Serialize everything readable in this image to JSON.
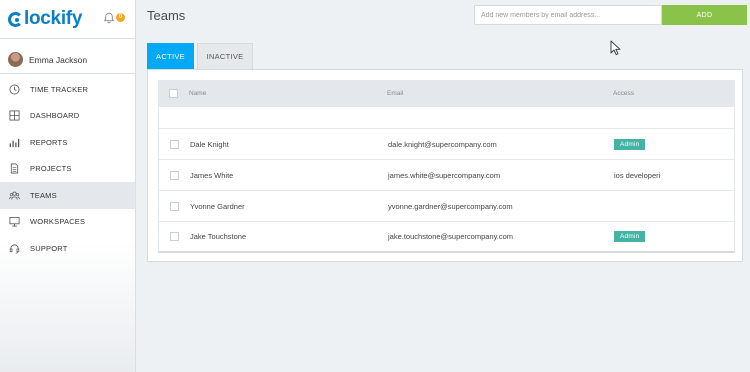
{
  "app": {
    "logo_text": "lockify",
    "notification_count": "0"
  },
  "user": {
    "name": "Emma Jackson"
  },
  "sidebar": {
    "items": [
      {
        "label": "TIME TRACKER",
        "icon": "clock-icon"
      },
      {
        "label": "DASHBOARD",
        "icon": "grid-icon"
      },
      {
        "label": "REPORTS",
        "icon": "bar-chart-icon"
      },
      {
        "label": "PROJECTS",
        "icon": "document-icon"
      },
      {
        "label": "TEAMS",
        "icon": "team-icon",
        "active": true
      },
      {
        "label": "WORKSPACES",
        "icon": "monitor-icon"
      },
      {
        "label": "SUPPORT",
        "icon": "headset-icon"
      }
    ]
  },
  "page": {
    "title": "Teams"
  },
  "invite": {
    "placeholder": "Add new members by email address...",
    "add_label": "ADD"
  },
  "tabs": {
    "active": "ACTIVE",
    "inactive": "INACTIVE"
  },
  "table": {
    "columns": {
      "name": "Name",
      "email": "Email",
      "access": "Access"
    },
    "rows": [
      {
        "name": "Dale Knight",
        "email": "dale.knight@supercompany.com",
        "access": "Admin",
        "access_badge": true
      },
      {
        "name": "James White",
        "email": "james.white@supercompany.com",
        "access": "ios developeri",
        "access_badge": false
      },
      {
        "name": "Yvonne Gardner",
        "email": "yvonne.gardner@supercompany.com",
        "access": "",
        "access_badge": false
      },
      {
        "name": "Jake Touchstone",
        "email": "jake.touchstone@supercompany.com",
        "access": "Admin",
        "access_badge": true
      }
    ]
  },
  "colors": {
    "brand": "#0b7fc4",
    "tab_active": "#03a9f4",
    "add_button": "#8bc34a",
    "admin_badge": "#45b3a4",
    "notification": "#f5a623"
  }
}
